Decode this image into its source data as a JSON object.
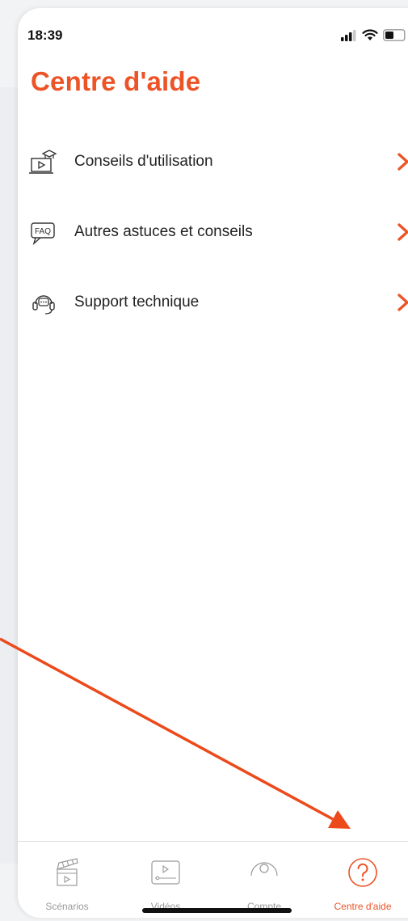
{
  "status_bar": {
    "time": "18:39",
    "icons": [
      "signal-icon",
      "wifi-icon",
      "battery-icon"
    ]
  },
  "header": {
    "title": "Centre d'aide"
  },
  "menu": {
    "items": [
      {
        "label": "Conseils d'utilisation",
        "icon": "video-tutorial-icon"
      },
      {
        "label": "Autres astuces et conseils",
        "icon": "faq-icon"
      },
      {
        "label": "Support technique",
        "icon": "support-headset-icon"
      }
    ]
  },
  "tab_bar": {
    "tabs": [
      {
        "label": "Scénarios",
        "icon": "clapperboard-icon",
        "active": false
      },
      {
        "label": "Vidéos",
        "icon": "video-player-icon",
        "active": false
      },
      {
        "label": "Compte",
        "icon": "account-icon",
        "active": false
      },
      {
        "label": "Centre d'aide",
        "icon": "help-icon",
        "active": true
      }
    ]
  },
  "colors": {
    "accent": "#ec5427",
    "text": "#222222",
    "inactive": "#9a9a9a",
    "annotation_arrow": "#ec4a1b"
  }
}
